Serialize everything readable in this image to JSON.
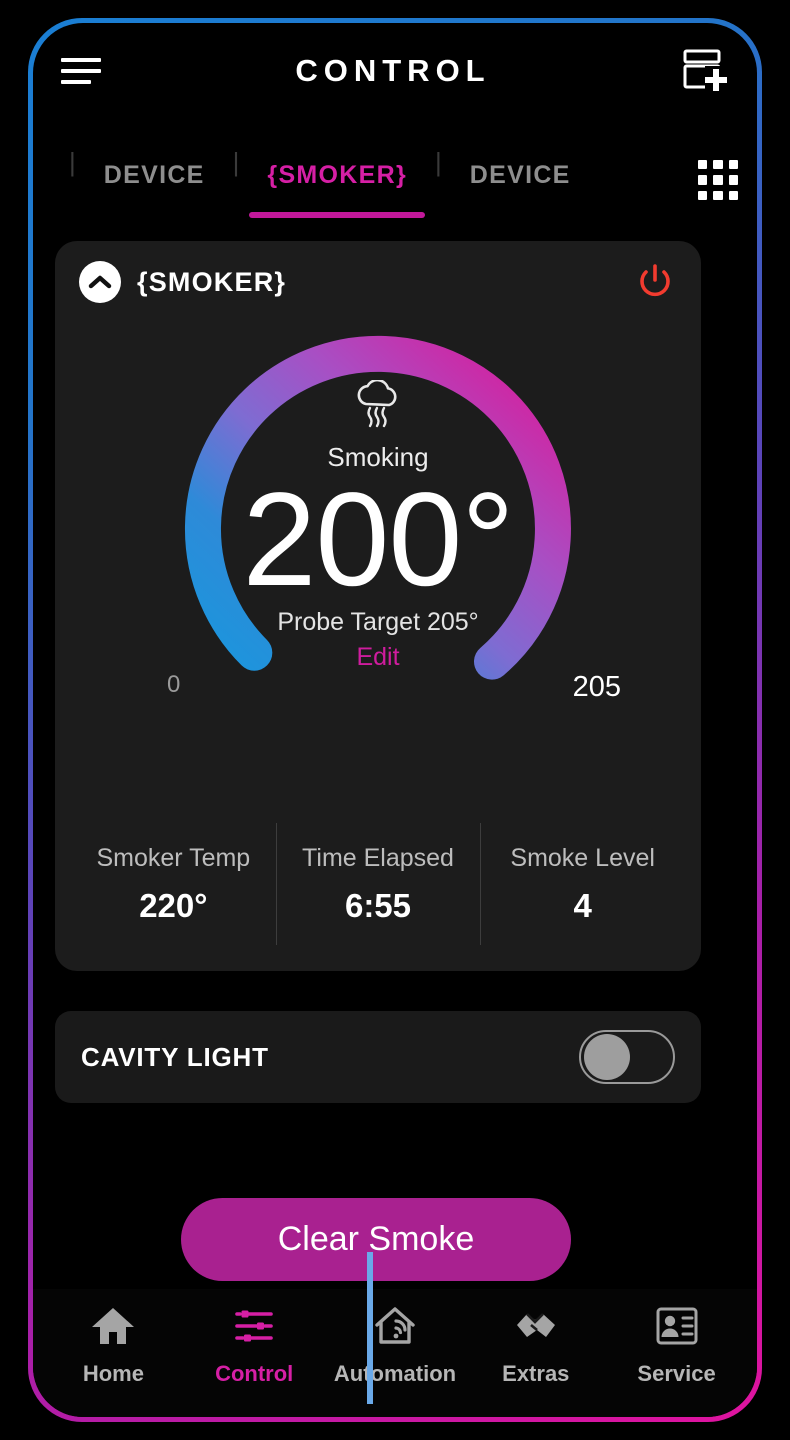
{
  "appbar": {
    "title": "CONTROL",
    "menu_icon": "hamburger-menu-icon",
    "add_icon": "add-card-icon"
  },
  "tabs": {
    "items": [
      {
        "label": "DEVICE",
        "active": false
      },
      {
        "label": "{SMOKER}",
        "active": true
      },
      {
        "label": "DEVICE",
        "active": false
      }
    ],
    "separator": "|",
    "grid_icon": "grid-apps-icon",
    "active_color": "#D61FA5"
  },
  "device_card": {
    "title": "{SMOKER}",
    "collapse_icon": "chevron-up-icon",
    "power_icon": "power-icon",
    "power_color": "#F23B2F",
    "gauge": {
      "mode_icon": "smoke-cloud-icon",
      "mode_label": "Smoking",
      "value": "200°",
      "probe_target": "Probe Target 205°",
      "edit_label": "Edit",
      "min_label": "0",
      "max_label": "205",
      "track_color": "#12282E",
      "gradient_start": "#1E94DC",
      "gradient_mid": "#7E6CD2",
      "gradient_end": "#D4219F"
    },
    "stats": [
      {
        "label": "Smoker Temp",
        "value": "220°"
      },
      {
        "label": "Time Elapsed",
        "value": "6:55"
      },
      {
        "label": "Smoke Level",
        "value": "4"
      }
    ]
  },
  "cavity_light": {
    "label": "CAVITY LIGHT",
    "state": "off"
  },
  "primary_action": {
    "label": "Clear Smoke",
    "color": "#A92190"
  },
  "bottom_nav": {
    "items": [
      {
        "label": "Home",
        "icon": "home-icon",
        "active": false
      },
      {
        "label": "Control",
        "icon": "sliders-icon",
        "active": true
      },
      {
        "label": "Automation",
        "icon": "home-wifi-icon",
        "active": false
      },
      {
        "label": "Extras",
        "icon": "handshake-icon",
        "active": false
      },
      {
        "label": "Service",
        "icon": "service-person-icon",
        "active": false
      }
    ]
  },
  "chart_data": {
    "type": "gauge",
    "title": "Smoker probe temperature",
    "value": 200,
    "min": 0,
    "max": 205,
    "unit": "°",
    "target": 205,
    "sweep_degrees": 270,
    "fraction_filled": 0.9756,
    "status": "Smoking",
    "tick_labels": [
      "0",
      "205"
    ]
  }
}
